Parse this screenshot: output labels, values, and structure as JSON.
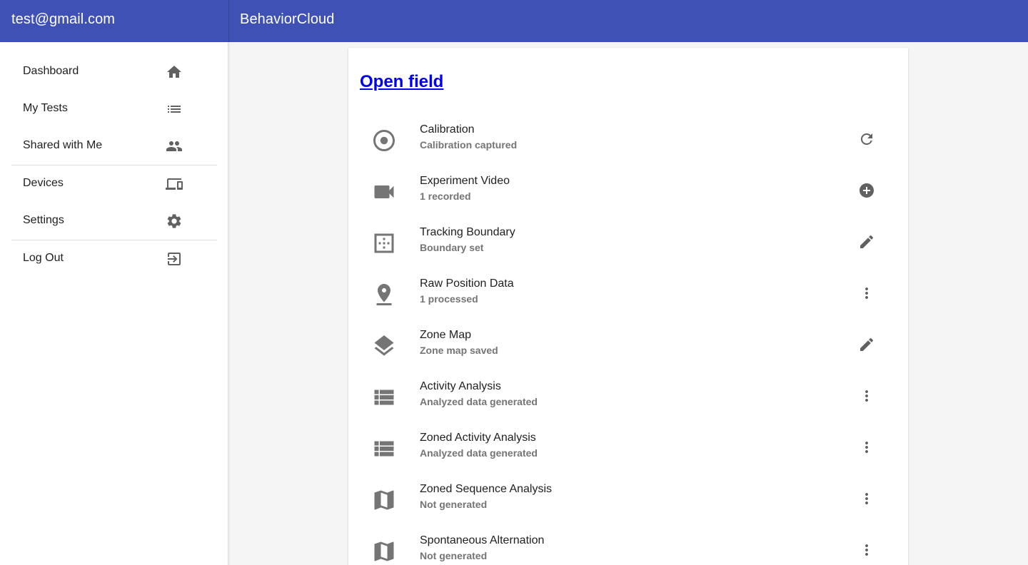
{
  "header": {
    "user_email": "test@gmail.com",
    "app_title": "BehaviorCloud",
    "color": "#3f51b5"
  },
  "sidebar": {
    "items": [
      {
        "label": "Dashboard",
        "icon": "home-icon"
      },
      {
        "label": "My Tests",
        "icon": "list-icon"
      },
      {
        "label": "Shared with Me",
        "icon": "people-icon"
      },
      {
        "label": "Devices",
        "icon": "devices-icon"
      },
      {
        "label": "Settings",
        "icon": "gear-icon"
      },
      {
        "label": "Log Out",
        "icon": "exit-icon"
      }
    ]
  },
  "main": {
    "title": "Open field",
    "rows": [
      {
        "primary": "Calibration",
        "secondary": "Calibration captured",
        "icon": "target-icon",
        "action": "refresh-icon"
      },
      {
        "primary": "Experiment Video",
        "secondary": "1 recorded",
        "icon": "videocam-icon",
        "action": "add-circle-icon"
      },
      {
        "primary": "Tracking Boundary",
        "secondary": "Boundary set",
        "icon": "boundary-icon",
        "action": "edit-icon"
      },
      {
        "primary": "Raw Position Data",
        "secondary": "1 processed",
        "icon": "pin-drop-icon",
        "action": "more-vert-icon"
      },
      {
        "primary": "Zone Map",
        "secondary": "Zone map saved",
        "icon": "layers-icon",
        "action": "edit-icon"
      },
      {
        "primary": "Activity Analysis",
        "secondary": "Analyzed data generated",
        "icon": "table-list-icon",
        "action": "more-vert-icon"
      },
      {
        "primary": "Zoned Activity Analysis",
        "secondary": "Analyzed data generated",
        "icon": "table-list-icon",
        "action": "more-vert-icon"
      },
      {
        "primary": "Zoned Sequence Analysis",
        "secondary": "Not generated",
        "icon": "map-icon",
        "action": "more-vert-icon"
      },
      {
        "primary": "Spontaneous Alternation",
        "secondary": "Not generated",
        "icon": "map-icon",
        "action": "more-vert-icon"
      }
    ]
  }
}
